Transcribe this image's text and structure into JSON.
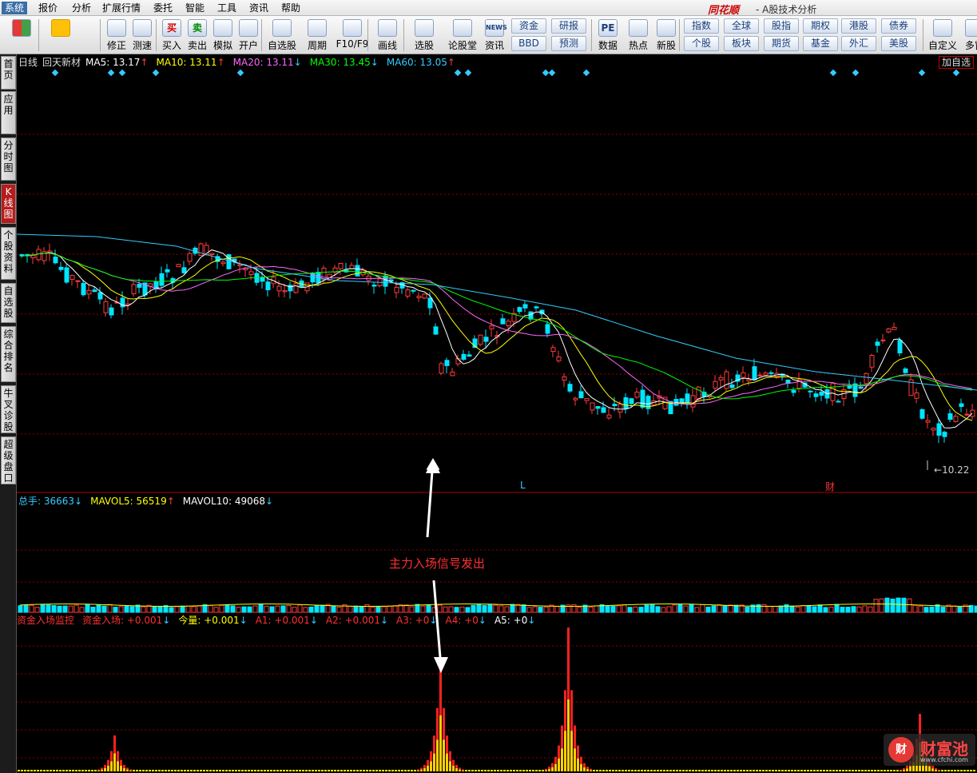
{
  "menu": {
    "items": [
      "系统",
      "报价",
      "分析",
      "扩展行情",
      "委托",
      "智能",
      "工具",
      "资讯",
      "帮助"
    ],
    "active": "系统"
  },
  "app": {
    "brand": "同花顺",
    "title": "- A股技术分析"
  },
  "toolbar": {
    "buttons": [
      {
        "label": "",
        "icon": "grid-icon"
      },
      {
        "label": "",
        "icon": "back-arrow-icon"
      },
      {
        "label": "修正",
        "icon": "up-down-icon"
      },
      {
        "label": "测速",
        "icon": "clock-icon"
      },
      {
        "label": "买入",
        "icon": "buy-icon",
        "glyph": "买"
      },
      {
        "label": "卖出",
        "icon": "sell-icon",
        "glyph": "卖"
      },
      {
        "label": "模拟",
        "icon": "hammer-icon"
      },
      {
        "label": "开户",
        "icon": "lock-icon"
      },
      {
        "label": "自选股",
        "icon": "star-icon"
      },
      {
        "label": "周期",
        "icon": "cycle-icon"
      },
      {
        "label": "F10/F9",
        "icon": "f10-icon"
      },
      {
        "label": "画线",
        "icon": "pencil-icon"
      },
      {
        "label": "选股",
        "icon": "screen-icon"
      },
      {
        "label": "论股堂",
        "icon": "forum-icon"
      },
      {
        "label": "资讯",
        "icon": "news-icon",
        "glyph": "NEWS"
      },
      {
        "label": "数据",
        "icon": "pe-icon",
        "glyph": "PE"
      },
      {
        "label": "热点",
        "icon": "hot-icon"
      },
      {
        "label": "新股",
        "icon": "ipo-icon"
      },
      {
        "label": "自定义",
        "icon": "custom-icon"
      },
      {
        "label": "多窗",
        "icon": "multi-window-icon"
      }
    ],
    "small_buttons": [
      [
        "资金",
        "BBD"
      ],
      [
        "研报",
        "预测"
      ],
      [
        "指数",
        "个股"
      ],
      [
        "全球",
        "板块"
      ],
      [
        "股指",
        "期货"
      ],
      [
        "期权",
        "基金"
      ],
      [
        "港股",
        "外汇"
      ],
      [
        "债券",
        "美股"
      ]
    ]
  },
  "sidebar": {
    "tabs": [
      "首页",
      "应用",
      "分时图",
      "K线图",
      "个股资料",
      "自选股",
      "综合排名",
      "牛叉诊股",
      "超级盘口"
    ],
    "active": "K线图"
  },
  "price_panel": {
    "period": "日线",
    "stock": "回天新材",
    "indicators": [
      {
        "label": "MA5: 13.17",
        "arrow": "↑",
        "color": "#ffffff"
      },
      {
        "label": "MA10: 13.11",
        "arrow": "↑",
        "color": "#ffff00"
      },
      {
        "label": "MA20: 13.11",
        "arrow": "↓",
        "color": "#ff66ff"
      },
      {
        "label": "MA30: 13.45",
        "arrow": "↓",
        "color": "#00ff00"
      },
      {
        "label": "MA60: 13.05",
        "arrow": "↑",
        "color": "#33ccff"
      }
    ],
    "add_watch": "加自选",
    "low_label": "10.22",
    "marker_l": "L",
    "marker_cai": "财"
  },
  "volume_panel": {
    "indicators": [
      {
        "label": "总手: 36663",
        "arrow": "↓",
        "color": "#33ccff"
      },
      {
        "label": "MAVOL5: 56519",
        "arrow": "↑",
        "color": "#ffff00"
      },
      {
        "label": "MAVOL10: 49068",
        "arrow": "↓",
        "color": "#ffffff"
      }
    ]
  },
  "fund_panel": {
    "indicators": [
      {
        "label": "资金入场监控",
        "arrow": "",
        "color": "#ff3030"
      },
      {
        "label": "资金入场: +0.001",
        "arrow": "↓",
        "color": "#ff3030"
      },
      {
        "label": "今量: +0.001",
        "arrow": "↓",
        "color": "#ffff00"
      },
      {
        "label": "A1: +0.001",
        "arrow": "↓",
        "color": "#ff3030"
      },
      {
        "label": "A2: +0.001",
        "arrow": "↓",
        "color": "#ff3030"
      },
      {
        "label": "A3: +0",
        "arrow": "↓",
        "color": "#ff3030"
      },
      {
        "label": "A4: +0",
        "arrow": "↓",
        "color": "#ff3030"
      },
      {
        "label": "A5: +0",
        "arrow": "↓",
        "color": "#ffffff"
      }
    ]
  },
  "annotation": "主力入场信号发出",
  "watermark": {
    "logo": "财",
    "text": "财富池",
    "url": "www.cfchi.com"
  },
  "colors": {
    "up": "#ff3b3b",
    "down": "#00e5ff",
    "grid": "#8b0000",
    "ma5": "#ffffff",
    "ma10": "#ffff00",
    "ma20": "#ff66ff",
    "ma30": "#00ff00",
    "ma60": "#33ccff"
  },
  "chart_data": {
    "type": "candlestick",
    "title": "回天新材 日线",
    "low_marked": 10.22,
    "fund_peaks": [
      {
        "index": "around 5%",
        "relative_height": 0.25
      },
      {
        "index": "around 44%",
        "relative_height": 0.78
      },
      {
        "index": "around 58%",
        "relative_height": 1.0
      },
      {
        "index": "around 95%",
        "relative_height": 0.4
      }
    ]
  }
}
